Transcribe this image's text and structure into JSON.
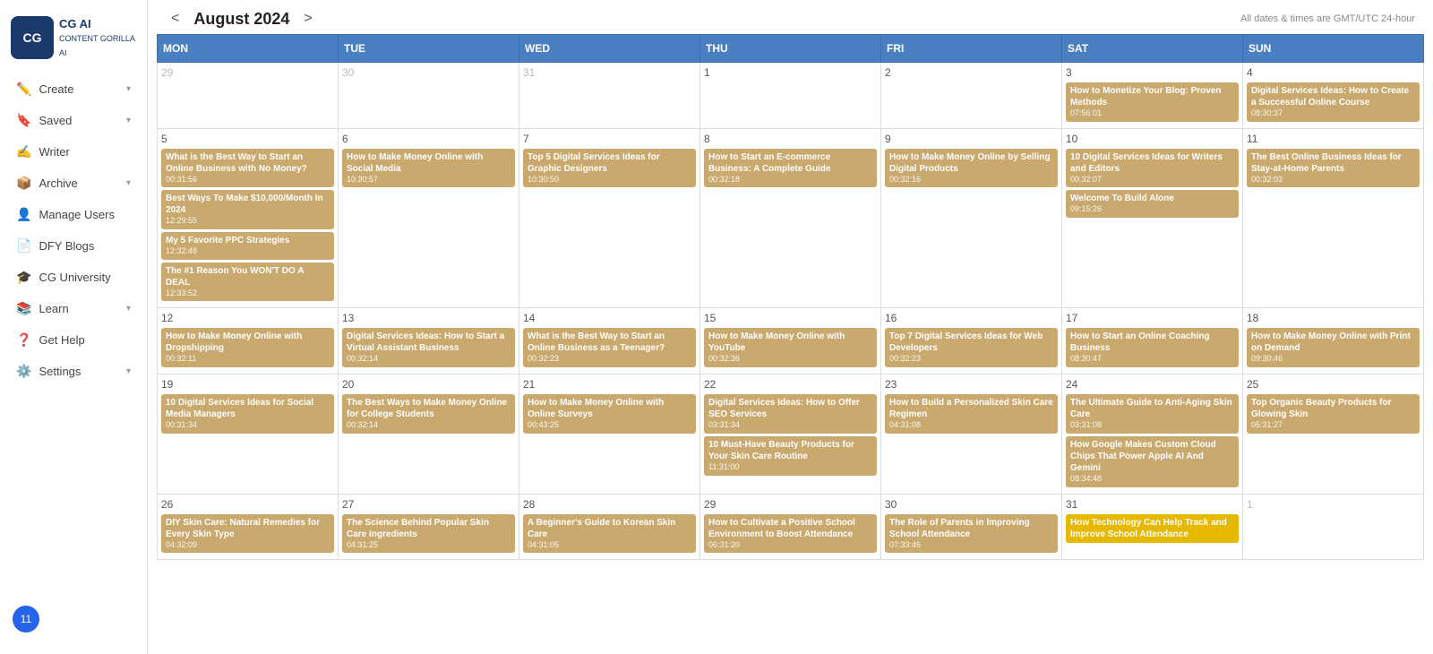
{
  "sidebar": {
    "logo_text": "CG AI\nCONTENT GORILLA AI",
    "items": [
      {
        "label": "Create",
        "icon": "✏️",
        "has_arrow": true
      },
      {
        "label": "Saved",
        "icon": "🔖",
        "has_arrow": true
      },
      {
        "label": "Writer",
        "icon": "✍️",
        "has_arrow": false
      },
      {
        "label": "Archive",
        "icon": "📦",
        "has_arrow": true
      },
      {
        "label": "Manage Users",
        "icon": "👤",
        "has_arrow": false
      },
      {
        "label": "DFY Blogs",
        "icon": "📄",
        "has_arrow": false
      },
      {
        "label": "CG University",
        "icon": "🎓",
        "has_arrow": false
      },
      {
        "label": "Learn",
        "icon": "📚",
        "has_arrow": true
      },
      {
        "label": "Get Help",
        "icon": "❓",
        "has_arrow": false
      },
      {
        "label": "Settings",
        "icon": "⚙️",
        "has_arrow": true
      }
    ],
    "notification_count": "11"
  },
  "header": {
    "prev_label": "<",
    "next_label": ">",
    "title": "August 2024",
    "timezone_note": "All dates & times are GMT/UTC 24-hour"
  },
  "calendar": {
    "days": [
      "MON",
      "TUE",
      "WED",
      "THU",
      "FRI",
      "SAT",
      "SUN"
    ],
    "weeks": [
      {
        "cells": [
          {
            "day": "29",
            "muted": true,
            "events": []
          },
          {
            "day": "30",
            "muted": true,
            "events": []
          },
          {
            "day": "31",
            "muted": true,
            "events": []
          },
          {
            "day": "1",
            "muted": false,
            "events": []
          },
          {
            "day": "2",
            "muted": false,
            "events": []
          },
          {
            "day": "3",
            "muted": false,
            "events": [
              {
                "title": "How to Monetize Your Blog: Proven Methods",
                "time": "07:56:01"
              }
            ]
          },
          {
            "day": "4",
            "muted": false,
            "events": [
              {
                "title": "Digital Services Ideas: How to Create a Successful Online Course",
                "time": "08:30:37"
              }
            ]
          }
        ]
      },
      {
        "cells": [
          {
            "day": "5",
            "muted": false,
            "events": [
              {
                "title": "What is the Best Way to Start an Online Business with No Money?",
                "time": "00:31:56"
              },
              {
                "title": "Best Ways To Make $10,000/Month In 2024",
                "time": "12:29:55"
              },
              {
                "title": "My 5 Favorite PPC Strategies",
                "time": "12:32:48"
              },
              {
                "title": "The #1 Reason You WON'T DO A DEAL",
                "time": "12:33:52"
              }
            ]
          },
          {
            "day": "6",
            "muted": false,
            "events": [
              {
                "title": "How to Make Money Online with Social Media",
                "time": "10:30:57"
              }
            ]
          },
          {
            "day": "7",
            "muted": false,
            "events": [
              {
                "title": "Top 5 Digital Services Ideas for Graphic Designers",
                "time": "10:30:50"
              }
            ]
          },
          {
            "day": "8",
            "muted": false,
            "events": [
              {
                "title": "How to Start an E-commerce Business: A Complete Guide",
                "time": "00:32:18"
              }
            ]
          },
          {
            "day": "9",
            "muted": false,
            "events": [
              {
                "title": "How to Make Money Online by Selling Digital Products",
                "time": "00:32:16"
              }
            ]
          },
          {
            "day": "10",
            "muted": false,
            "events": [
              {
                "title": "10 Digital Services Ideas for Writers and Editors",
                "time": "00:32:07"
              },
              {
                "title": "Welcome To Build Alone",
                "time": "09:15:26"
              }
            ]
          },
          {
            "day": "11",
            "muted": false,
            "events": [
              {
                "title": "The Best Online Business Ideas for Stay-at-Home Parents",
                "time": "00:32:03"
              }
            ]
          }
        ]
      },
      {
        "cells": [
          {
            "day": "12",
            "muted": false,
            "events": [
              {
                "title": "How to Make Money Online with Dropshipping",
                "time": "00:32:11"
              }
            ]
          },
          {
            "day": "13",
            "muted": false,
            "events": [
              {
                "title": "Digital Services Ideas: How to Start a Virtual Assistant Business",
                "time": "00:32:14"
              }
            ]
          },
          {
            "day": "14",
            "muted": false,
            "events": [
              {
                "title": "What is the Best Way to Start an Online Business as a Teenager?",
                "time": "00:32:23"
              }
            ]
          },
          {
            "day": "15",
            "muted": false,
            "events": [
              {
                "title": "How to Make Money Online with YouTube",
                "time": "00:32:36"
              }
            ]
          },
          {
            "day": "16",
            "muted": false,
            "events": [
              {
                "title": "Top 7 Digital Services Ideas for Web Developers",
                "time": "00:32:23"
              }
            ]
          },
          {
            "day": "17",
            "muted": false,
            "events": [
              {
                "title": "How to Start an Online Coaching Business",
                "time": "08:30:47"
              }
            ]
          },
          {
            "day": "18",
            "muted": false,
            "events": [
              {
                "title": "How to Make Money Online with Print on Demand",
                "time": "09:30:46"
              }
            ]
          }
        ]
      },
      {
        "cells": [
          {
            "day": "19",
            "muted": false,
            "events": [
              {
                "title": "10 Digital Services Ideas for Social Media Managers",
                "time": "00:31:34"
              }
            ]
          },
          {
            "day": "20",
            "muted": false,
            "events": [
              {
                "title": "The Best Ways to Make Money Online for College Students",
                "time": "00:32:14"
              }
            ]
          },
          {
            "day": "21",
            "muted": false,
            "events": [
              {
                "title": "How to Make Money Online with Online Surveys",
                "time": "00:43:25"
              }
            ]
          },
          {
            "day": "22",
            "muted": false,
            "events": [
              {
                "title": "Digital Services Ideas: How to Offer SEO Services",
                "time": "03:31:34"
              },
              {
                "title": "10 Must-Have Beauty Products for Your Skin Care Routine",
                "time": "11:31:00"
              }
            ]
          },
          {
            "day": "23",
            "muted": false,
            "events": [
              {
                "title": "How to Build a Personalized Skin Care Regimen",
                "time": "04:31:08"
              }
            ]
          },
          {
            "day": "24",
            "muted": false,
            "events": [
              {
                "title": "The Ultimate Guide to Anti-Aging Skin Care",
                "time": "03:31:08"
              },
              {
                "title": "How Google Makes Custom Cloud Chips That Power Apple AI And Gemini",
                "time": "08:34:48"
              }
            ]
          },
          {
            "day": "25",
            "muted": false,
            "events": [
              {
                "title": "Top Organic Beauty Products for Glowing Skin",
                "time": "05:31:27"
              }
            ]
          }
        ]
      },
      {
        "cells": [
          {
            "day": "26",
            "muted": false,
            "events": [
              {
                "title": "DIY Skin Care: Natural Remedies for Every Skin Type",
                "time": "04:32:09"
              }
            ]
          },
          {
            "day": "27",
            "muted": false,
            "events": [
              {
                "title": "The Science Behind Popular Skin Care Ingredients",
                "time": "04:31:25"
              }
            ]
          },
          {
            "day": "28",
            "muted": false,
            "events": [
              {
                "title": "A Beginner's Guide to Korean Skin Care",
                "time": "04:31:05"
              }
            ]
          },
          {
            "day": "29",
            "muted": false,
            "events": [
              {
                "title": "How to Cultivate a Positive School Environment to Boost Attendance",
                "time": "06:31:20"
              }
            ]
          },
          {
            "day": "30",
            "muted": false,
            "events": [
              {
                "title": "The Role of Parents in Improving School Attendance",
                "time": "07:33:46"
              }
            ]
          },
          {
            "day": "31",
            "muted": false,
            "events": [
              {
                "title": "How Technology Can Help Track and Improve School Attendance",
                "time": "",
                "yellow": true
              }
            ]
          },
          {
            "day": "1",
            "muted": true,
            "events": []
          }
        ]
      }
    ]
  }
}
